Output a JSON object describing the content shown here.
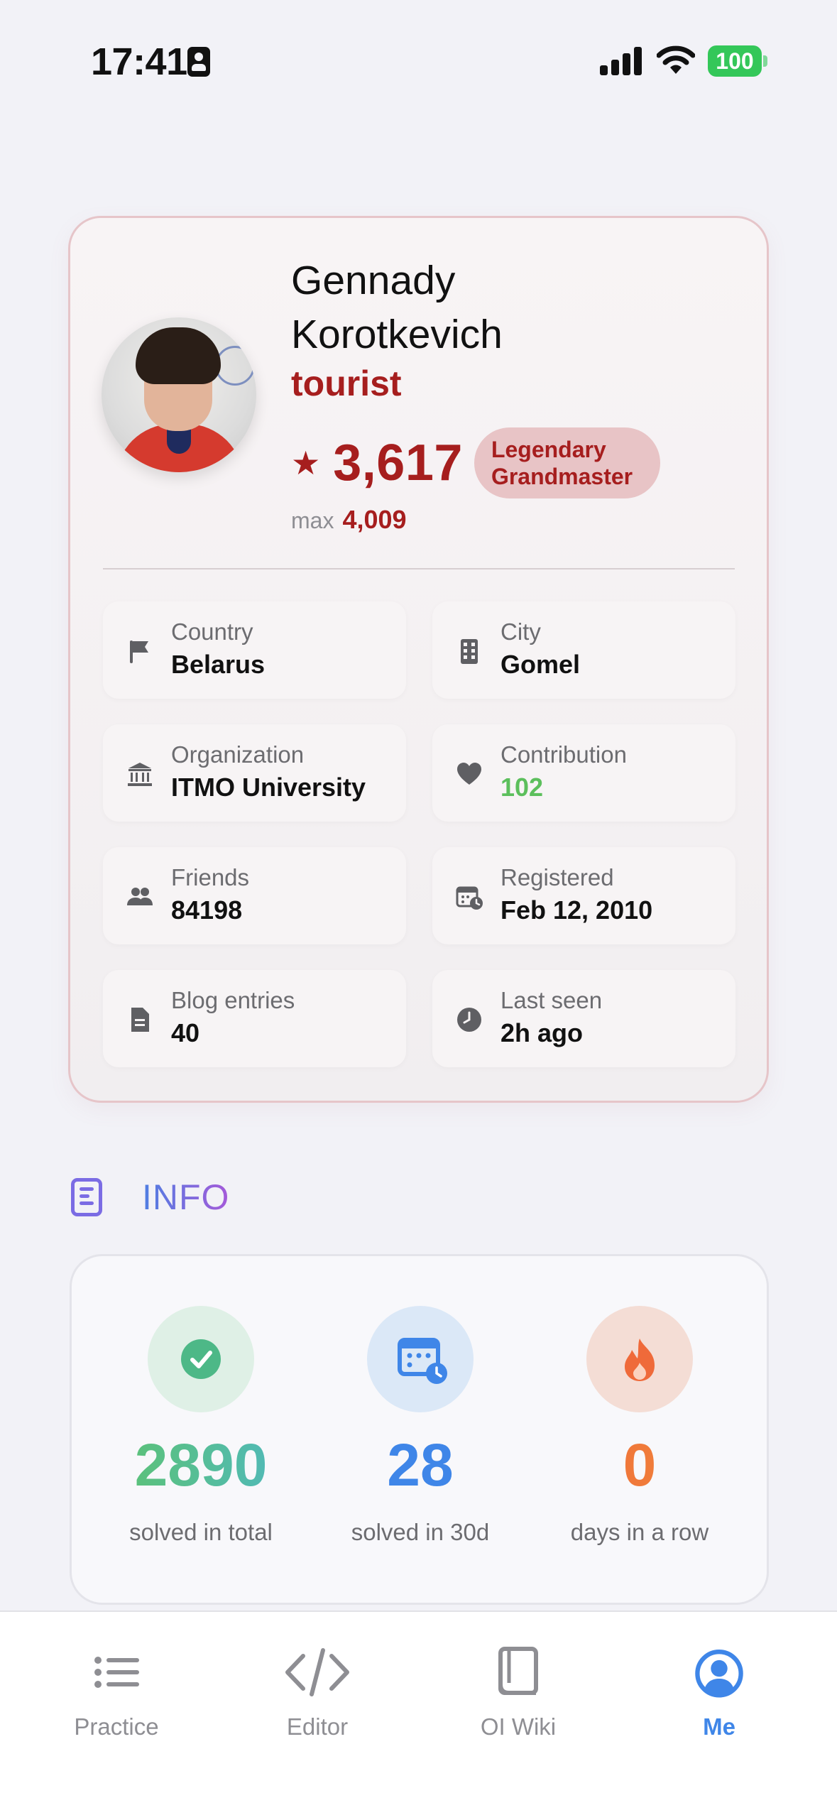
{
  "status_bar": {
    "time": "17:41",
    "battery": "100"
  },
  "profile": {
    "name_line1": "Gennady",
    "name_line2": "Korotkevich",
    "handle": "tourist",
    "star": "★",
    "rating": "3,617",
    "rank_line1": "Legendary",
    "rank_line2": "Grandmaster",
    "max_label": "max",
    "max_rating": "4,009",
    "accent_color": "#a61e1e"
  },
  "tiles": [
    {
      "label": "Country",
      "value": "Belarus",
      "icon": "flag-icon"
    },
    {
      "label": "City",
      "value": "Gomel",
      "icon": "building-icon"
    },
    {
      "label": "Organization",
      "value": "ITMO University",
      "icon": "institution-icon"
    },
    {
      "label": "Contribution",
      "value": "102",
      "icon": "heart-icon"
    },
    {
      "label": "Friends",
      "value": "84198",
      "icon": "people-icon"
    },
    {
      "label": "Registered",
      "value": "Feb 12, 2010",
      "icon": "calendar-clock-icon"
    },
    {
      "label": "Blog entries",
      "value": "40",
      "icon": "document-icon"
    },
    {
      "label": "Last seen",
      "value": "2h ago",
      "icon": "clock-icon"
    }
  ],
  "info": {
    "title": "INFO",
    "stats": [
      {
        "value": "2890",
        "caption": "solved in total",
        "icon": "checkmark-icon"
      },
      {
        "value": "28",
        "caption": "solved in 30d",
        "icon": "calendar-icon"
      },
      {
        "value": "0",
        "caption": "days in a row",
        "icon": "flame-icon"
      }
    ]
  },
  "tab_bar": {
    "tabs": [
      {
        "label": "Practice",
        "icon": "list-icon"
      },
      {
        "label": "Editor",
        "icon": "code-icon"
      },
      {
        "label": "OI Wiki",
        "icon": "book-icon"
      },
      {
        "label": "Me",
        "icon": "person-circle-icon"
      }
    ],
    "active": "Me",
    "active_color": "#3f86e8"
  }
}
